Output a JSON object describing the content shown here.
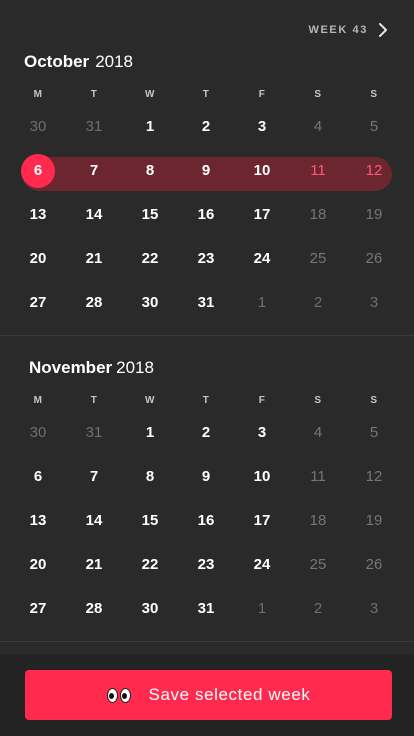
{
  "header": {
    "week_label": "WEEK 43"
  },
  "weekdays": [
    "M",
    "T",
    "W",
    "T",
    "F",
    "S",
    "S"
  ],
  "months": [
    {
      "name": "October",
      "year": "2018",
      "weeks": [
        [
          {
            "d": "30",
            "s": "out"
          },
          {
            "d": "31",
            "s": "out"
          },
          {
            "d": "1",
            "s": "in"
          },
          {
            "d": "2",
            "s": "in"
          },
          {
            "d": "3",
            "s": "in"
          },
          {
            "d": "4",
            "s": "weekend"
          },
          {
            "d": "5",
            "s": "weekend"
          }
        ],
        [
          {
            "d": "6",
            "s": "today"
          },
          {
            "d": "7",
            "s": "in"
          },
          {
            "d": "8",
            "s": "in"
          },
          {
            "d": "9",
            "s": "in"
          },
          {
            "d": "10",
            "s": "in"
          },
          {
            "d": "11",
            "s": "sel-weekend"
          },
          {
            "d": "12",
            "s": "sel-weekend"
          }
        ],
        [
          {
            "d": "13",
            "s": "in"
          },
          {
            "d": "14",
            "s": "in"
          },
          {
            "d": "15",
            "s": "in"
          },
          {
            "d": "16",
            "s": "in"
          },
          {
            "d": "17",
            "s": "in"
          },
          {
            "d": "18",
            "s": "weekend"
          },
          {
            "d": "19",
            "s": "weekend"
          }
        ],
        [
          {
            "d": "20",
            "s": "in"
          },
          {
            "d": "21",
            "s": "in"
          },
          {
            "d": "22",
            "s": "in"
          },
          {
            "d": "23",
            "s": "in"
          },
          {
            "d": "24",
            "s": "in"
          },
          {
            "d": "25",
            "s": "weekend"
          },
          {
            "d": "26",
            "s": "weekend"
          }
        ],
        [
          {
            "d": "27",
            "s": "in"
          },
          {
            "d": "28",
            "s": "in"
          },
          {
            "d": "30",
            "s": "in"
          },
          {
            "d": "31",
            "s": "in"
          },
          {
            "d": "1",
            "s": "out"
          },
          {
            "d": "2",
            "s": "out"
          },
          {
            "d": "3",
            "s": "out"
          }
        ]
      ],
      "selected_week": 1
    },
    {
      "name": "November",
      "year": "2018",
      "weeks": [
        [
          {
            "d": "30",
            "s": "out"
          },
          {
            "d": "31",
            "s": "out"
          },
          {
            "d": "1",
            "s": "in"
          },
          {
            "d": "2",
            "s": "in"
          },
          {
            "d": "3",
            "s": "in"
          },
          {
            "d": "4",
            "s": "weekend"
          },
          {
            "d": "5",
            "s": "weekend"
          }
        ],
        [
          {
            "d": "6",
            "s": "in"
          },
          {
            "d": "7",
            "s": "in"
          },
          {
            "d": "8",
            "s": "in"
          },
          {
            "d": "9",
            "s": "in"
          },
          {
            "d": "10",
            "s": "in"
          },
          {
            "d": "11",
            "s": "weekend"
          },
          {
            "d": "12",
            "s": "weekend"
          }
        ],
        [
          {
            "d": "13",
            "s": "in"
          },
          {
            "d": "14",
            "s": "in"
          },
          {
            "d": "15",
            "s": "in"
          },
          {
            "d": "16",
            "s": "in"
          },
          {
            "d": "17",
            "s": "in"
          },
          {
            "d": "18",
            "s": "weekend"
          },
          {
            "d": "19",
            "s": "weekend"
          }
        ],
        [
          {
            "d": "20",
            "s": "in"
          },
          {
            "d": "21",
            "s": "in"
          },
          {
            "d": "22",
            "s": "in"
          },
          {
            "d": "23",
            "s": "in"
          },
          {
            "d": "24",
            "s": "in"
          },
          {
            "d": "25",
            "s": "weekend"
          },
          {
            "d": "26",
            "s": "weekend"
          }
        ],
        [
          {
            "d": "27",
            "s": "in"
          },
          {
            "d": "28",
            "s": "in"
          },
          {
            "d": "30",
            "s": "in"
          },
          {
            "d": "31",
            "s": "in"
          },
          {
            "d": "1",
            "s": "out"
          },
          {
            "d": "2",
            "s": "out"
          },
          {
            "d": "3",
            "s": "out"
          }
        ]
      ],
      "selected_week": null
    }
  ],
  "footer": {
    "save_label": "Save selected week",
    "icon": "eyes-icon"
  },
  "colors": {
    "background": "#2a2a2b",
    "accent": "#ff2a4d",
    "week_highlight": "#6b2630",
    "selected_weekend_text": "#ff5a75"
  }
}
